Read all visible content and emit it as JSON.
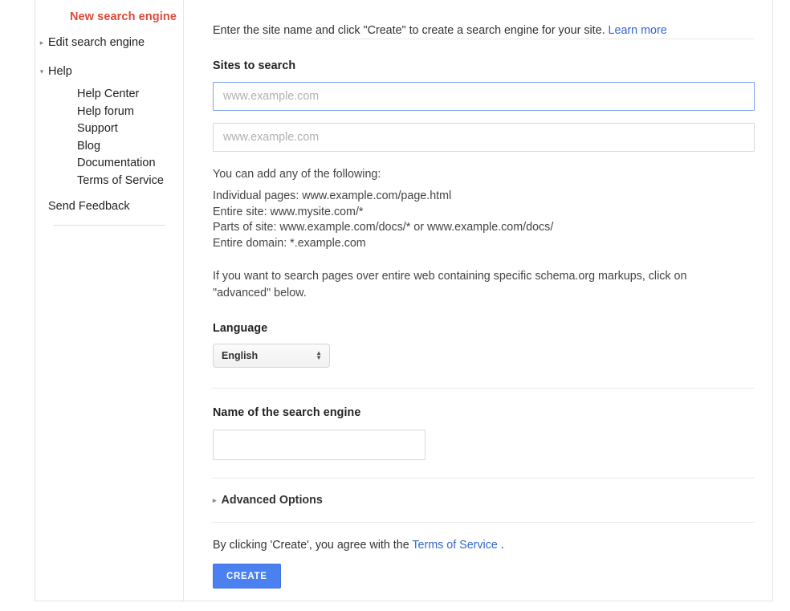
{
  "sidebar": {
    "title": "New search engine",
    "edit_item": {
      "label": "Edit search engine",
      "arrow": "▸"
    },
    "help_item": {
      "label": "Help",
      "arrow": "▾"
    },
    "help_children": [
      "Help Center",
      "Help forum",
      "Support",
      "Blog",
      "Documentation",
      "Terms of Service"
    ],
    "feedback": "Send Feedback"
  },
  "content": {
    "intro_text": "Enter the site name and click \"Create\" to create a search engine for your site.",
    "intro_link": "Learn more",
    "sites_heading": "Sites to search",
    "site_input_1": {
      "value": "",
      "placeholder": "www.example.com"
    },
    "site_input_2": {
      "value": "",
      "placeholder": "www.example.com"
    },
    "hint_lead": "You can add any of the following:",
    "hint_lines": "Individual pages: www.example.com/page.html\nEntire site: www.mysite.com/*\nParts of site: www.example.com/docs/* or www.example.com/docs/\nEntire domain: *.example.com",
    "schema_note": "If you want to search pages over entire web containing specific schema.org markups, click on \"advanced\" below.",
    "language_heading": "Language",
    "language_value": "English",
    "language_options": [
      "English"
    ],
    "select_arrow_up": "▲",
    "select_arrow_down": "▼",
    "name_heading": "Name of the search engine",
    "name_input": {
      "value": "",
      "placeholder": ""
    },
    "advanced_label": "Advanced Options",
    "advanced_arrow": "▸",
    "agree_prefix": "By clicking 'Create', you agree with the",
    "agree_link": "Terms of Service",
    "agree_suffix": ".",
    "create_label": "CREATE"
  },
  "colors": {
    "brand_red": "#dd4b39",
    "link_blue": "#3366cc",
    "button_blue": "#4a80f0",
    "focus_border": "#7da2f0"
  }
}
